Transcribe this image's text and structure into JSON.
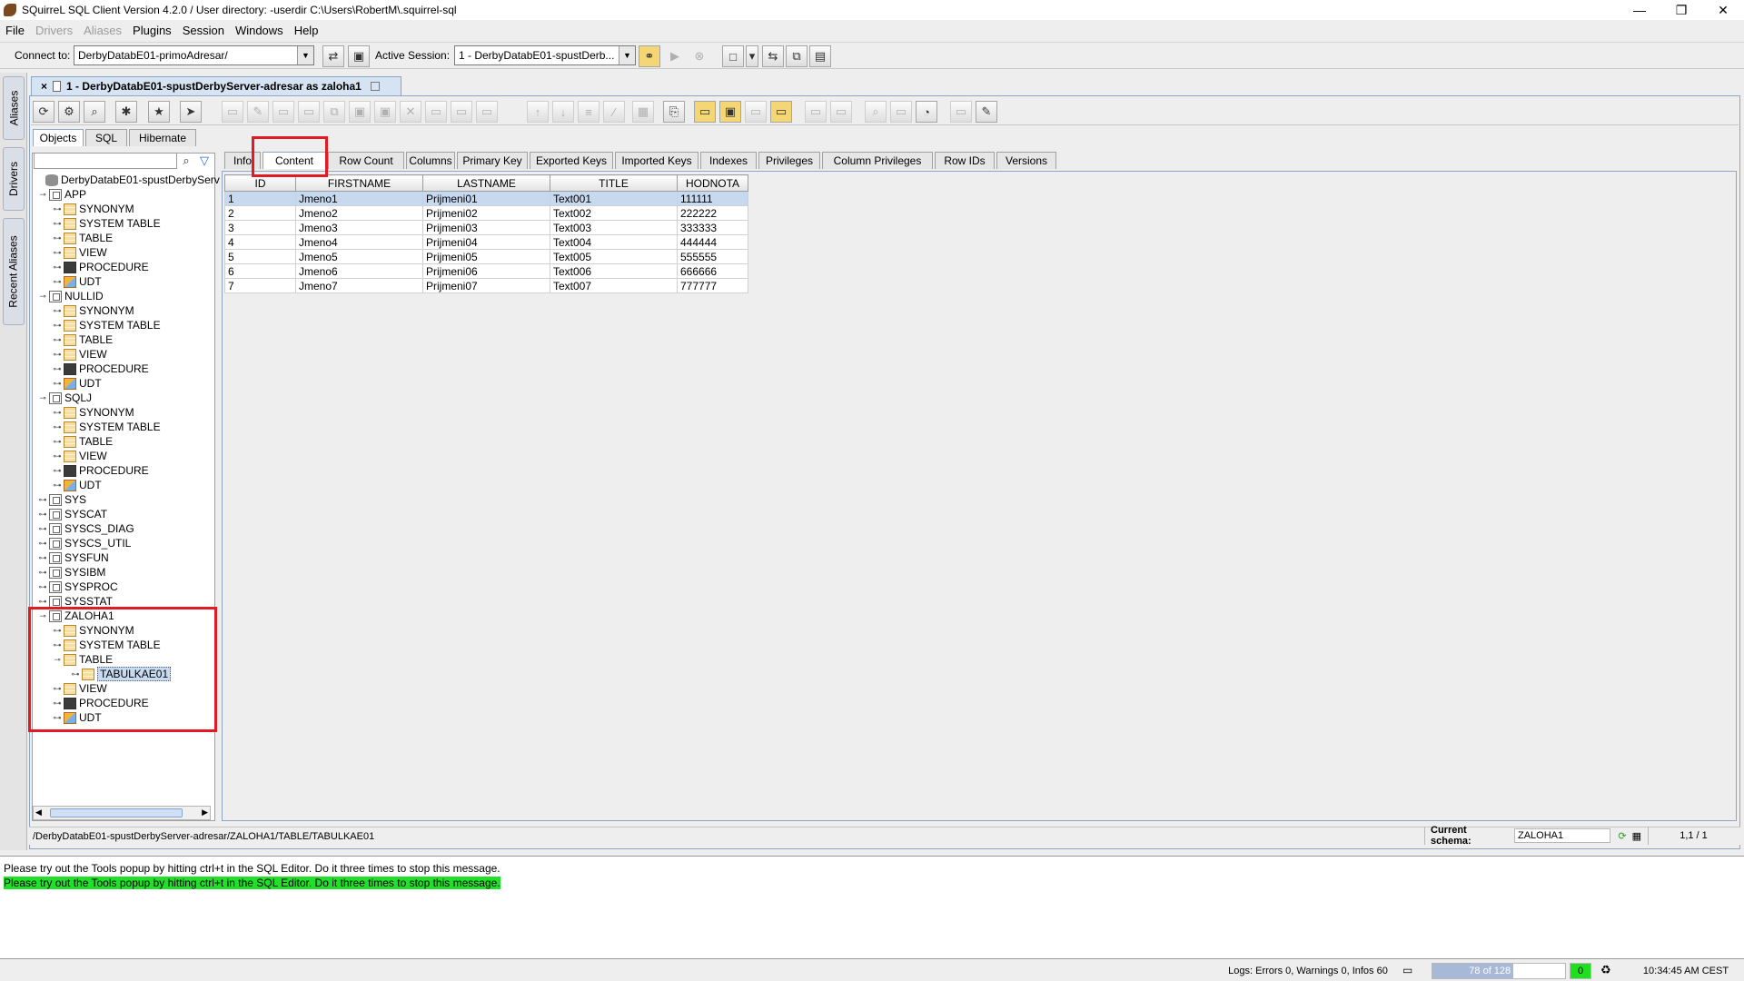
{
  "window": {
    "title": "SQuirreL SQL Client Version 4.2.0 / User directory: -userdir C:\\Users\\RobertM\\.squirrel-sql",
    "minimize": "—",
    "maximize": "❐",
    "close": "✕"
  },
  "menu": [
    {
      "label": "File",
      "enabled": true
    },
    {
      "label": "Drivers",
      "enabled": false
    },
    {
      "label": "Aliases",
      "enabled": false
    },
    {
      "label": "Plugins",
      "enabled": true
    },
    {
      "label": "Session",
      "enabled": true
    },
    {
      "label": "Windows",
      "enabled": true
    },
    {
      "label": "Help",
      "enabled": true
    }
  ],
  "connect": {
    "label": "Connect to:",
    "value": "DerbyDatabE01-primoAdresar/",
    "active_session_label": "Active Session:",
    "active_session_value": "1 - DerbyDatabE01-spustDerb..."
  },
  "vtabs": [
    "Aliases",
    "Drivers",
    "Recent Aliases"
  ],
  "session_tab": {
    "close": "×",
    "label": "1 - DerbyDatabE01-spustDerbyServer-adresar  as zaloha1"
  },
  "object_tabs": [
    "Objects",
    "SQL",
    "Hibernate"
  ],
  "detail_tabs": [
    "Info",
    "Content",
    "Row Count",
    "Columns",
    "Primary Key",
    "Exported Keys",
    "Imported Keys",
    "Indexes",
    "Privileges",
    "Column Privileges",
    "Row IDs",
    "Versions"
  ],
  "tree": {
    "root": "DerbyDatabE01-spustDerbyServ",
    "schemas": [
      {
        "name": "APP",
        "children": [
          "SYNONYM",
          "SYSTEM TABLE",
          "TABLE",
          "VIEW",
          "PROCEDURE",
          "UDT"
        ]
      },
      {
        "name": "NULLID",
        "children": [
          "SYNONYM",
          "SYSTEM TABLE",
          "TABLE",
          "VIEW",
          "PROCEDURE",
          "UDT"
        ]
      },
      {
        "name": "SQLJ",
        "children": [
          "SYNONYM",
          "SYSTEM TABLE",
          "TABLE",
          "VIEW",
          "PROCEDURE",
          "UDT"
        ]
      },
      {
        "name": "SYS"
      },
      {
        "name": "SYSCAT"
      },
      {
        "name": "SYSCS_DIAG"
      },
      {
        "name": "SYSCS_UTIL"
      },
      {
        "name": "SYSFUN"
      },
      {
        "name": "SYSIBM"
      },
      {
        "name": "SYSPROC"
      },
      {
        "name": "SYSSTAT"
      },
      {
        "name": "ZALOHA1",
        "children": [
          "SYNONYM",
          "SYSTEM TABLE",
          "TABLE",
          "TABULKAE01",
          "VIEW",
          "PROCEDURE",
          "UDT"
        ]
      }
    ]
  },
  "grid": {
    "columns": [
      "ID",
      "FIRSTNAME",
      "LASTNAME",
      "TITLE",
      "HODNOTA"
    ],
    "rows": [
      [
        "1",
        "Jmeno1",
        "Prijmeni01",
        "Text001",
        "111111"
      ],
      [
        "2",
        "Jmeno2",
        "Prijmeni02",
        "Text002",
        "222222"
      ],
      [
        "3",
        "Jmeno3",
        "Prijmeni03",
        "Text003",
        "333333"
      ],
      [
        "4",
        "Jmeno4",
        "Prijmeni04",
        "Text004",
        "444444"
      ],
      [
        "5",
        "Jmeno5",
        "Prijmeni05",
        "Text005",
        "555555"
      ],
      [
        "6",
        "Jmeno6",
        "Prijmeni06",
        "Text006",
        "666666"
      ],
      [
        "7",
        "Jmeno7",
        "Prijmeni07",
        "Text007",
        "777777"
      ]
    ]
  },
  "status": {
    "path": "/DerbyDatabE01-spustDerbyServer-adresar/ZALOHA1/TABLE/TABULKAE01",
    "schema_label": "Current schema:",
    "schema_value": "ZALOHA1",
    "position": "1,1 / 1"
  },
  "messages": [
    "Please try out the Tools popup by hitting ctrl+t in the SQL Editor. Do it three times to stop this message.",
    "Please try out the Tools popup by hitting ctrl+t in the SQL Editor. Do it three times to stop this message."
  ],
  "bottom": {
    "logs": "Logs: Errors 0, Warnings 0, Infos 60",
    "memory": "78 of 128 MB",
    "memory_used_fraction": 0.61,
    "counter": "0",
    "time": "10:34:45 AM CEST"
  },
  "colors": {
    "highlight": "#e01b24",
    "green_msg": "#22e02a",
    "selection": "#c7d9ef"
  }
}
